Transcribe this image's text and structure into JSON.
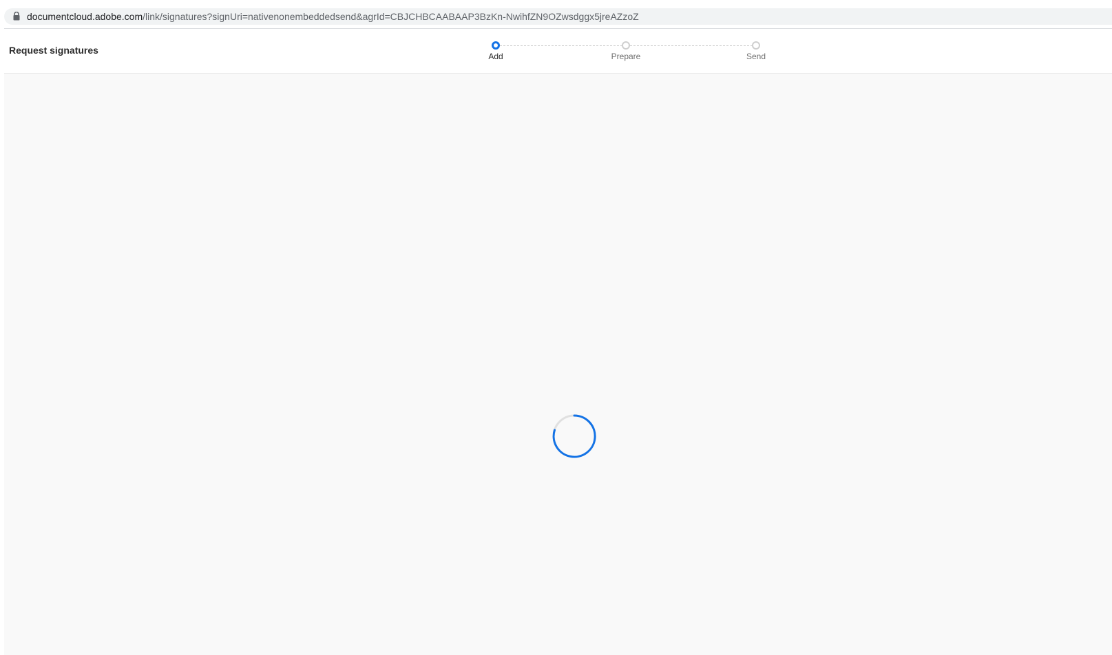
{
  "browser": {
    "url_host": "documentcloud.adobe.com",
    "url_path": "/link/signatures?signUri=nativenonembeddedsend&agrId=CBJCHBCAABAAP3BzKn-NwihfZN9OZwsdggx5jreAZzoZ",
    "lock_icon": "lock-icon"
  },
  "header": {
    "title": "Request signatures"
  },
  "stepper": {
    "steps": [
      {
        "label": "Add",
        "state": "active"
      },
      {
        "label": "Prepare",
        "state": "inactive"
      },
      {
        "label": "Send",
        "state": "inactive"
      }
    ]
  },
  "main": {
    "loading_icon": "loading-spinner-icon"
  },
  "colors": {
    "accent": "#1473e6",
    "inactive_step": "#cfcfcf",
    "content_bg": "#f9f9f9"
  }
}
